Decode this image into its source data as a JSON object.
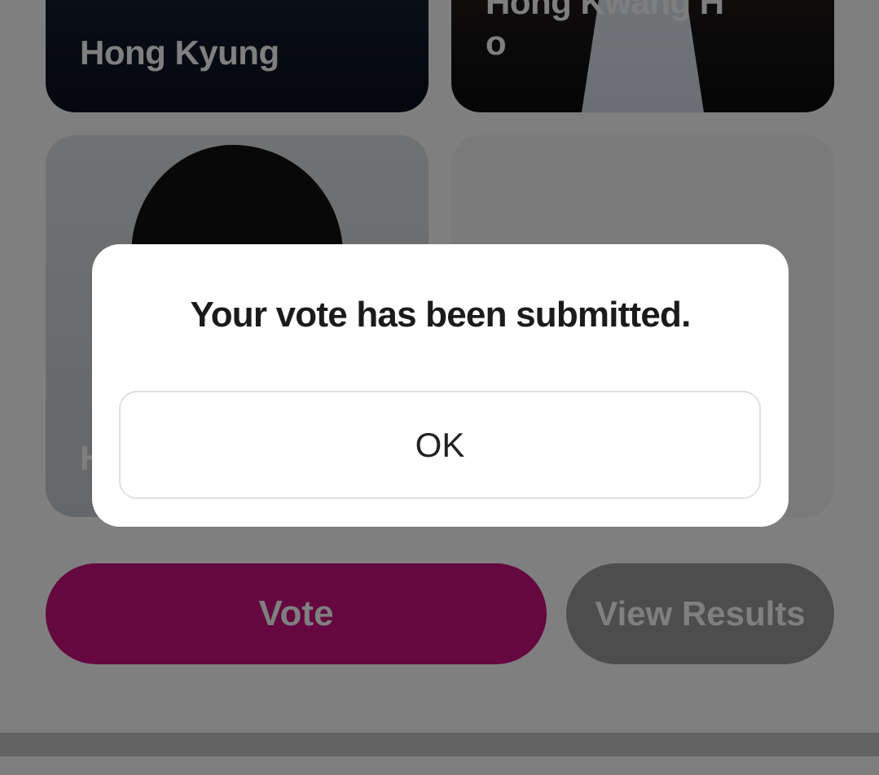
{
  "candidates": [
    {
      "name": "Hong Kyung"
    },
    {
      "name": "Hong Kwang Ho"
    },
    {
      "name": "H"
    }
  ],
  "actions": {
    "vote_label": "Vote",
    "results_label": "View Results"
  },
  "dialog": {
    "message": "Your vote has been submitted.",
    "ok_label": "OK"
  },
  "colors": {
    "accent": "#c8107e",
    "secondary_button": "#9b9b9b",
    "overlay": "rgba(0,0,0,0.5)"
  }
}
